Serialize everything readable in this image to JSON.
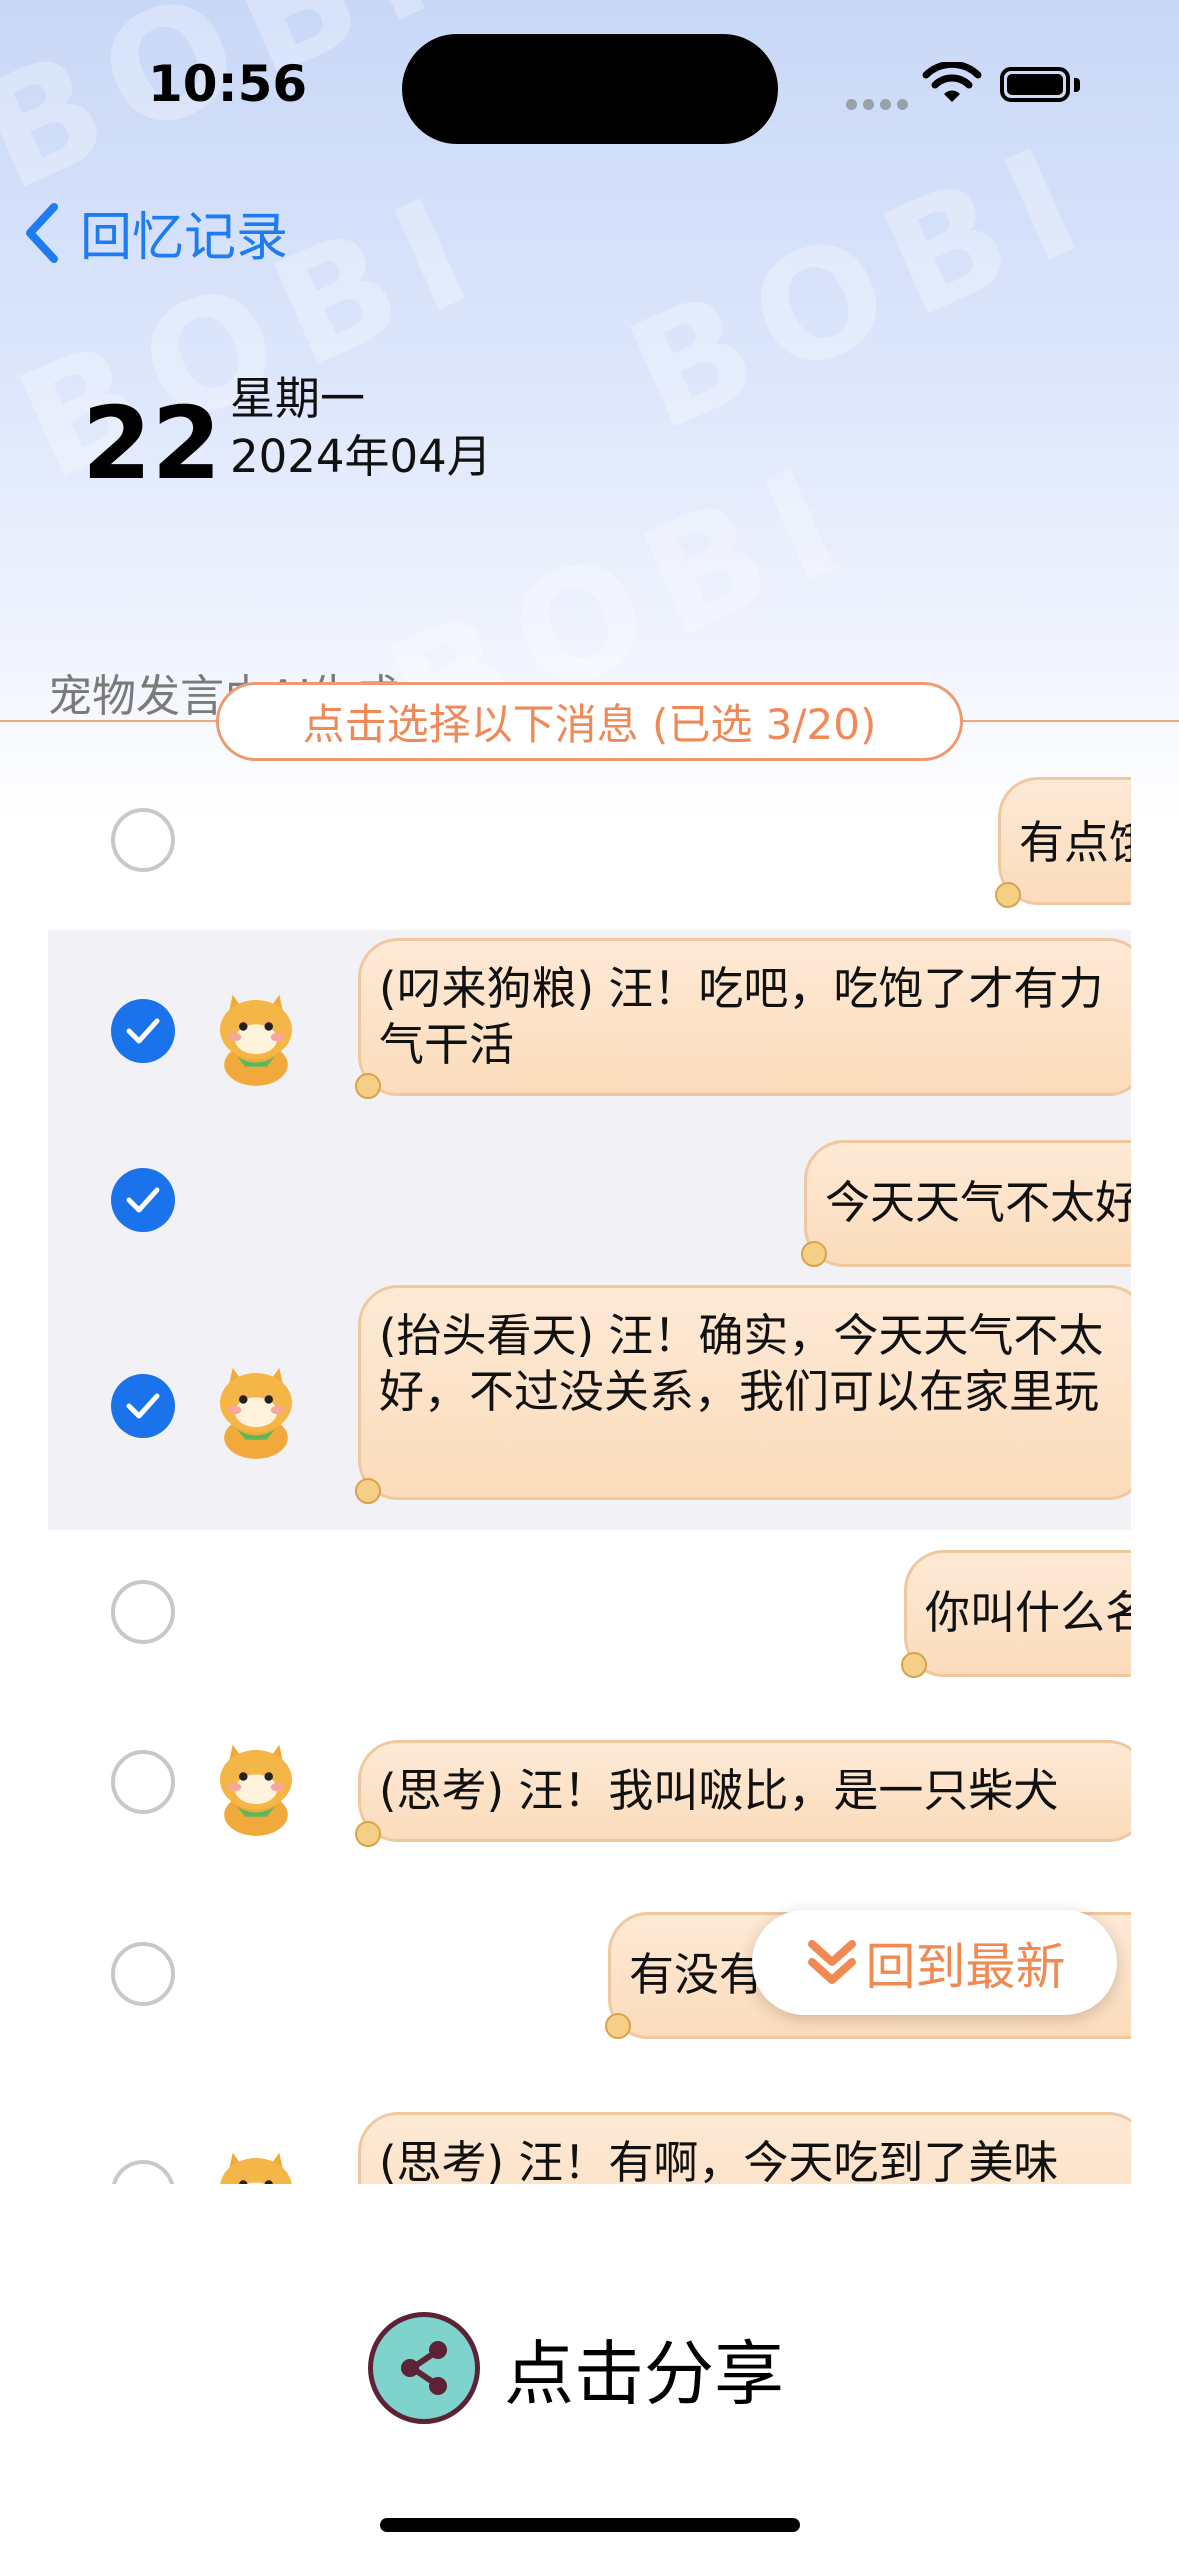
{
  "status_bar": {
    "time": "10:56"
  },
  "nav": {
    "back_label": "回忆记录"
  },
  "date": {
    "day": "22",
    "weekday": "星期一",
    "year_month": "2024年04月"
  },
  "ai_note": "宠物发言由AI生成",
  "selection": {
    "label": "点击选择以下消息 (已选 3/20)"
  },
  "messages": [
    {
      "sender": "user",
      "text": "有点饿了",
      "selected": false
    },
    {
      "sender": "pet",
      "text": "(叼来狗粮) 汪！吃吧，吃饱了才有力气干活",
      "selected": true
    },
    {
      "sender": "user",
      "text": "今天天气不太好",
      "selected": true
    },
    {
      "sender": "pet",
      "text": "(抬头看天) 汪！确实，今天天气不太好，不过没关系，我们可以在家里玩",
      "selected": true
    },
    {
      "sender": "user",
      "text": "你叫什么名字",
      "selected": false
    },
    {
      "sender": "pet",
      "text": "(思考) 汪！我叫啵比，是一只柴犬",
      "selected": false
    },
    {
      "sender": "user",
      "text": "有没有吃到好吃的一",
      "selected": false
    },
    {
      "sender": "pet",
      "text": "(思考) 汪！有啊，今天吃到了美味",
      "selected": false
    }
  ],
  "back_to_latest": {
    "label": "回到最新",
    "icon": "double-chevron-down-icon"
  },
  "share": {
    "label": "点击分享",
    "icon": "share-icon"
  },
  "colors": {
    "accent": "#1a73ea",
    "orange": "#ef8a58",
    "bubble": "#fde3c8",
    "share_bg": "#7fd3cd"
  }
}
